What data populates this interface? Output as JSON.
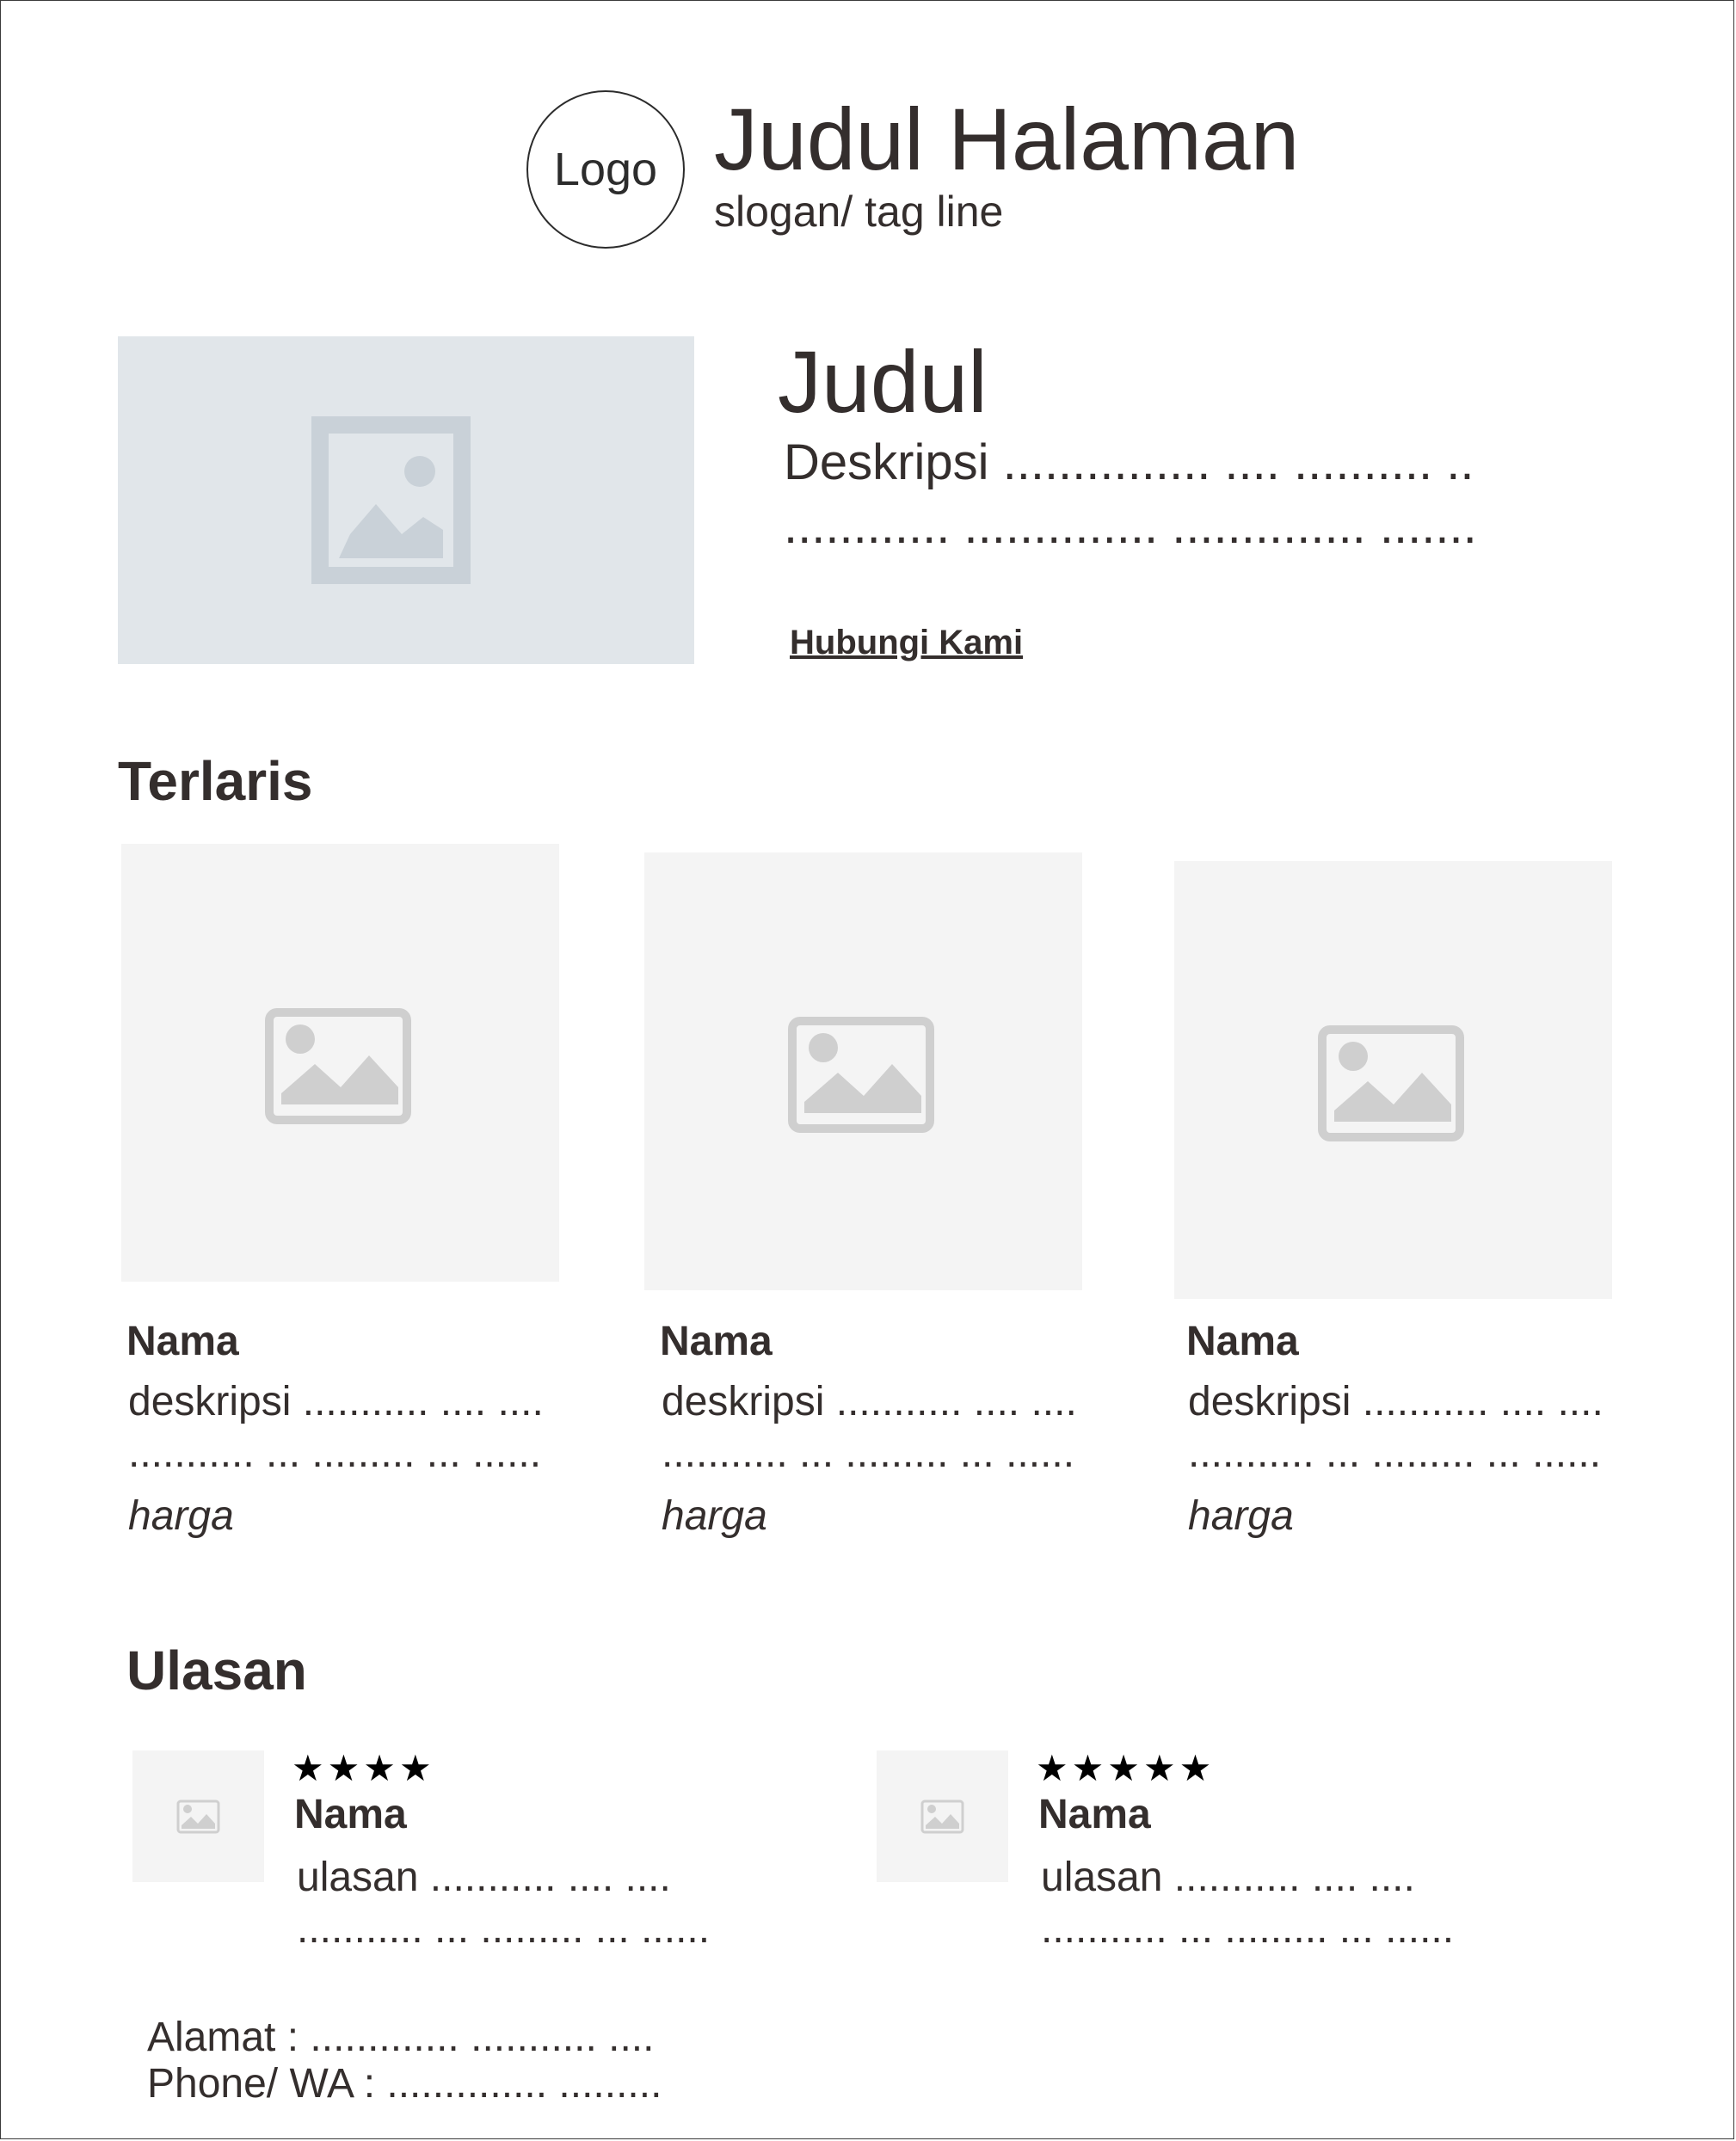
{
  "header": {
    "logo_label": "Logo",
    "title": "Judul Halaman",
    "slogan": "slogan/ tag line"
  },
  "hero": {
    "title": "Judul",
    "description_line1": "Deskripsi ............... .... .......... ..",
    "description_line2": "............ .............. .............. .......",
    "contact_link": "Hubungi Kami"
  },
  "bestsellers": {
    "heading": "Terlaris",
    "products": [
      {
        "name": "Nama",
        "desc_line1": "deskripsi ........... .... ....",
        "desc_line2": "........... ... ......... ... ......",
        "price": "harga"
      },
      {
        "name": "Nama",
        "desc_line1": "deskripsi ........... .... ....",
        "desc_line2": "........... ... ......... ... ......",
        "price": "harga"
      },
      {
        "name": "Nama",
        "desc_line1": "deskripsi ........... .... ....",
        "desc_line2": "........... ... ......... ... ......",
        "price": "harga"
      }
    ]
  },
  "reviews": {
    "heading": "Ulasan",
    "items": [
      {
        "stars": "★★★★",
        "rating": 4,
        "name": "Nama",
        "text_line1": "ulasan ........... .... ....",
        "text_line2": "........... ... ......... ... ......"
      },
      {
        "stars": "★★★★★",
        "rating": 5,
        "name": "Nama",
        "text_line1": "ulasan ........... .... ....",
        "text_line2": "........... ... ......... ... ......"
      }
    ]
  },
  "footer": {
    "address": "Alamat : ............. ........... ....",
    "phone": "Phone/ WA : .............. ........."
  },
  "colors": {
    "text": "#342e2d",
    "hero_placeholder": "#e1e6ea",
    "hero_icon": "#c9d1d8",
    "card_placeholder": "#f4f4f4",
    "card_icon": "#cfcfcf"
  }
}
